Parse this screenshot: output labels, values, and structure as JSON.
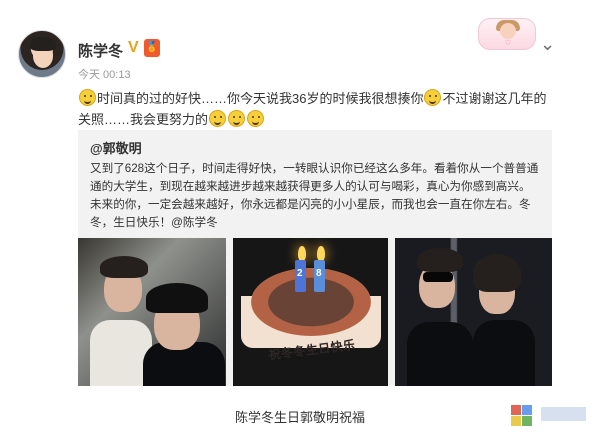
{
  "post": {
    "author": "陈学冬",
    "verified_mark": "V",
    "member_badge": "🏅",
    "time": "今天 00:13",
    "text_segments": [
      "时间真的过的好快……你今天说我36岁的时候我很想揍你",
      "不过谢谢这几年的关照……我会更努力的"
    ]
  },
  "repost": {
    "author": "@郭敬明",
    "text": "又到了628这个日子，时间走得好快，一转眼认识你已经这么多年。看着你从一个普普通通的大学生，到现在越来越进步越来越获得更多人的认可与喝彩，真心为你感到高兴。未来的你，一定会越来越好，你永远都是闪亮的小小星辰，而我也会一直在你左右。冬冬，生日快乐！@陈学冬"
  },
  "images": {
    "cake_text": "祝冬冬生日快乐",
    "candles": [
      "2",
      "8"
    ]
  },
  "footer": {
    "caption": "陈学冬生日郭敬明祝福"
  },
  "decor": {
    "chibi_text": "♡"
  },
  "icons": {
    "avatar": "avatar",
    "verified": "verified-badge-icon",
    "member": "member-badge-icon",
    "menu": "chevron-down-icon",
    "emoji": "smile-emoji-icon"
  },
  "colors": {
    "link": "#eb7350",
    "repost_bg": "#f2f2f2",
    "verified": "#e8a51c",
    "member": "#f05a2c"
  }
}
